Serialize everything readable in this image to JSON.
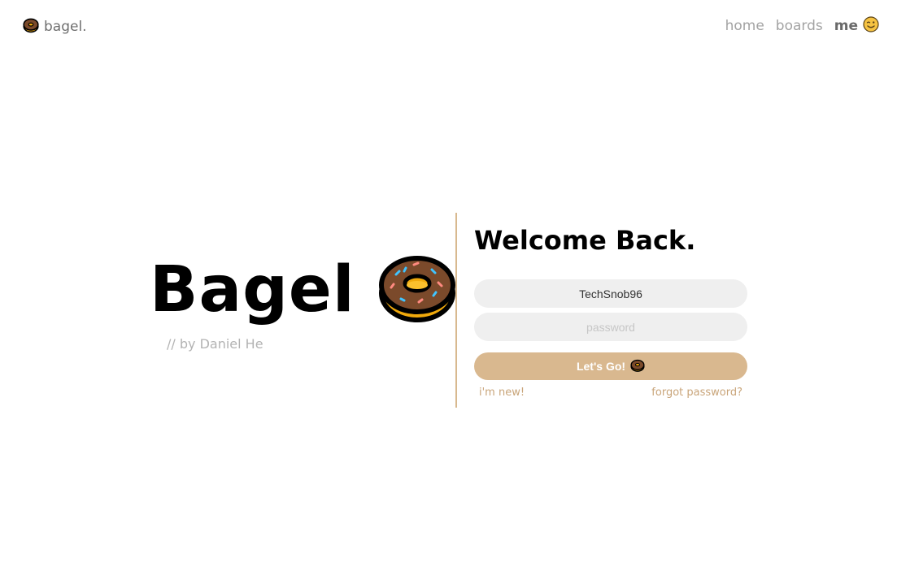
{
  "nav": {
    "brand_label": "bagel.",
    "brand_icon": "donut-icon",
    "items": [
      {
        "label": "home"
      },
      {
        "label": "boards"
      },
      {
        "label": "me",
        "icon": "winking-face-icon",
        "active": true
      }
    ]
  },
  "hero": {
    "title": "Bagel",
    "icon": "donut-icon",
    "subtitle": "// by Daniel He"
  },
  "login": {
    "heading": "Welcome Back.",
    "username_value": "TechSnob96",
    "password_placeholder": "password",
    "submit_label": "Let's Go!",
    "submit_icon": "donut-icon",
    "signup_link": "i'm new!",
    "forgot_link": "forgot password?"
  },
  "colors": {
    "accent": "#d9b88f",
    "divider": "#d8b98f",
    "link": "#c9a57a",
    "field_bg": "#efefef",
    "nav_muted": "#a3a3a3",
    "donut_dough": "#f0a90c",
    "donut_icing": "#7b4a2b"
  }
}
